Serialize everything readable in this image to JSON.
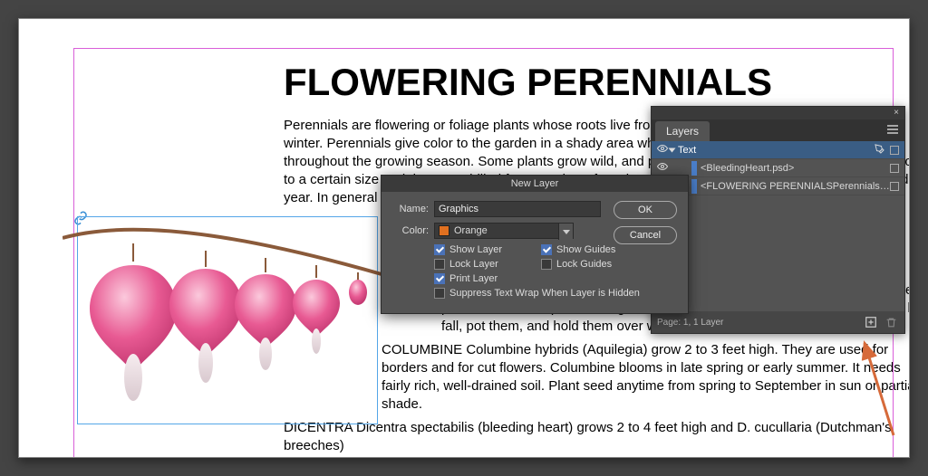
{
  "document": {
    "headline": "FLOWERING PERENNIALS",
    "para1": "Perennials are flowering or foliage plants whose roots live from year to year. Their tops die back in the winter. Perennials give color to the garden in a shady area where many are colorful in spring and throughout the growing season. Some plants grow wild, and perennials will not flower unless they develop to a certain size and then are chilled for a number of weeks. Winter treatment is the result of this second year. In general they do well in most parts of the country.",
    "para2_part": "rock gardens. Carnation blooms in late spring, and needs a sunny spot. Space plants 12 inches apart. Seed germinates in about 20 days. Cut plants back in late fall, pot them, and hold them over winter in a coldframe.",
    "para3": "COLUMBINE Columbine hybrids (Aquilegia) grow 2 to 3 feet high. They are used for borders and for cut flowers. Columbine blooms in late spring or early summer. It needs fairly rich, well-drained soil. Plant seed anytime from spring to September in sun or partial shade.",
    "para4": "DICENTRA Dicentra spectabilis (bleeding heart) grows 2 to 4 feet high and D. cucullaria (Dutchman's breeches)"
  },
  "layers_panel": {
    "tab": "Layers",
    "layer_name": "Text",
    "sub1": "<BleedingHeart.psd>",
    "sub2": "<FLOWERING PERENNIALSPerennials ...>",
    "footer": "Page: 1, 1 Layer"
  },
  "dialog": {
    "title": "New Layer",
    "name_label": "Name:",
    "name_value": "Graphics",
    "color_label": "Color:",
    "color_value": "Orange",
    "show_layer": "Show Layer",
    "show_guides": "Show Guides",
    "lock_layer": "Lock Layer",
    "lock_guides": "Lock Guides",
    "print_layer": "Print Layer",
    "suppress": "Suppress Text Wrap When Layer is Hidden",
    "ok": "OK",
    "cancel": "Cancel"
  }
}
